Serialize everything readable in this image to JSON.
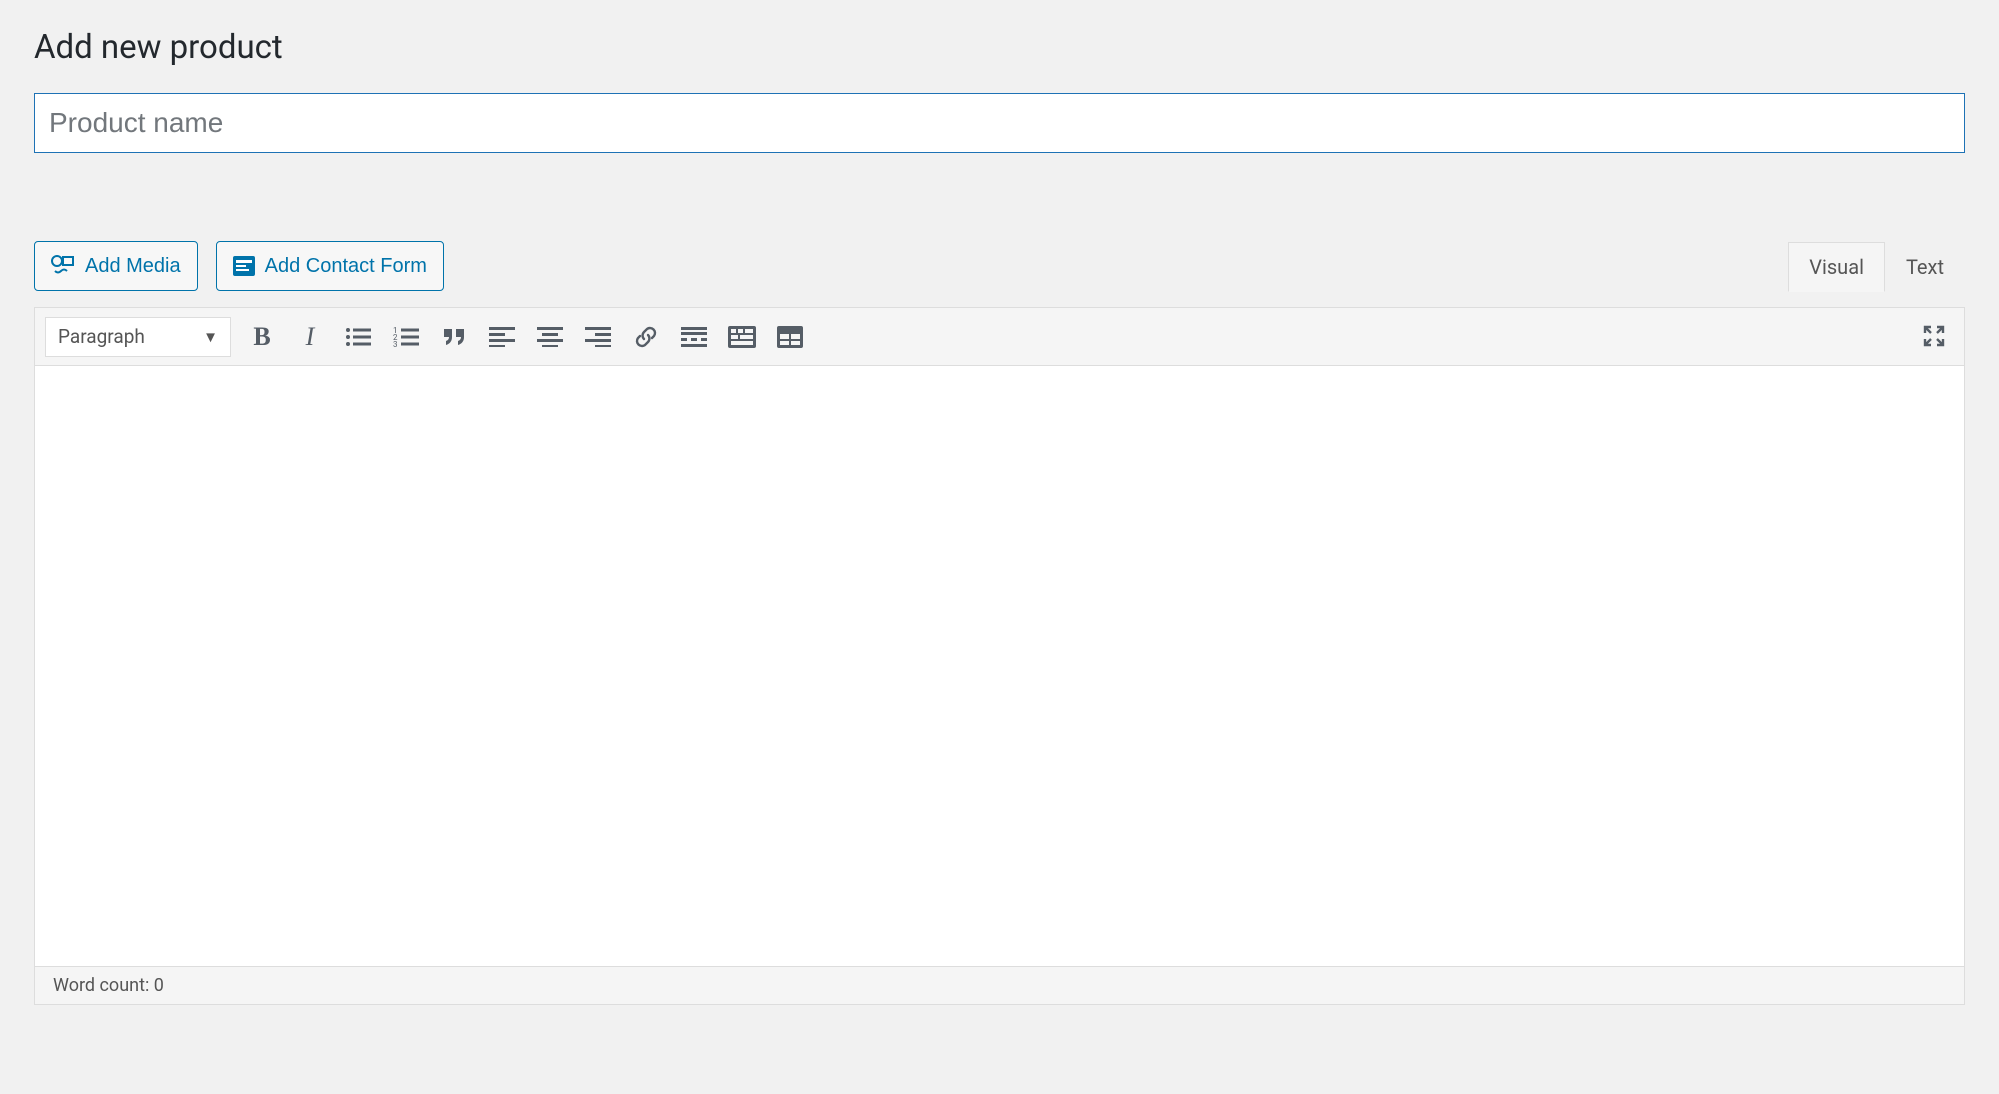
{
  "page": {
    "title": "Add new product"
  },
  "titleField": {
    "placeholder": "Product name",
    "value": ""
  },
  "mediaButtons": {
    "addMedia": "Add Media",
    "addContactForm": "Add Contact Form"
  },
  "tabs": {
    "visual": "Visual",
    "text": "Text",
    "active": "visual"
  },
  "toolbar": {
    "formatSelector": {
      "selected": "Paragraph"
    },
    "buttons": {
      "bold": "Bold",
      "italic": "Italic",
      "bulletList": "Bulleted list",
      "numberList": "Numbered list",
      "blockquote": "Blockquote",
      "alignLeft": "Align left",
      "alignCenter": "Align center",
      "alignRight": "Align right",
      "link": "Insert/edit link",
      "readMore": "Insert Read More tag",
      "toolbarToggle": "Toolbar Toggle",
      "table": "Table",
      "fullscreen": "Fullscreen"
    }
  },
  "editor": {
    "content": ""
  },
  "statusBar": {
    "wordCountLabel": "Word count: ",
    "wordCount": 0
  }
}
